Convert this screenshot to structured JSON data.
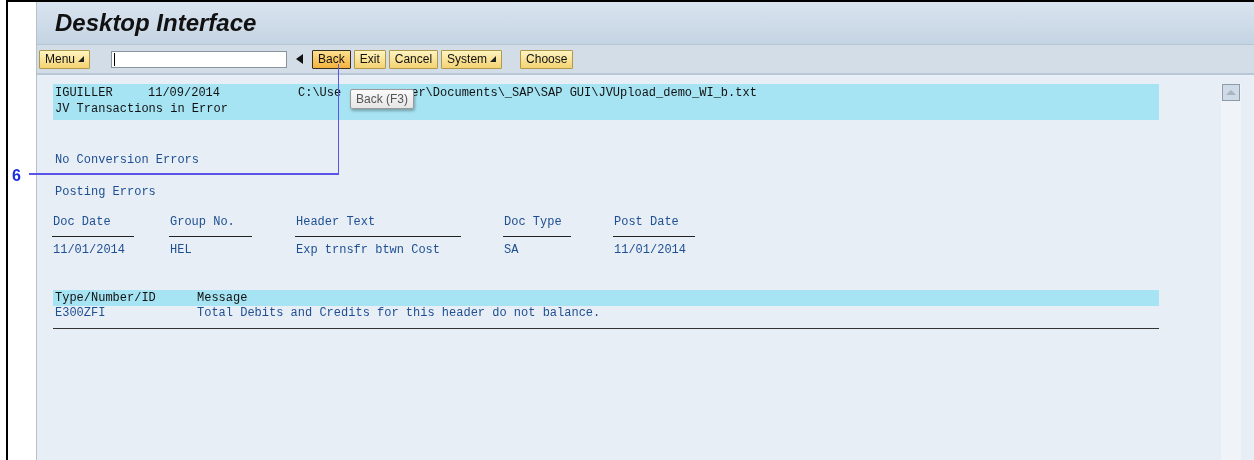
{
  "window": {
    "title": "Desktop Interface"
  },
  "toolbar": {
    "buttons": [
      {
        "label": "Menu",
        "kind": "dropdown",
        "hovered": false
      }
    ],
    "nav_buttons": [
      {
        "label": "Back",
        "kind": "plain",
        "hovered": true
      },
      {
        "label": "Exit",
        "kind": "plain",
        "hovered": false
      },
      {
        "label": "Cancel",
        "kind": "plain",
        "hovered": false
      },
      {
        "label": "System",
        "kind": "dropdown",
        "hovered": false
      }
    ],
    "choose_button": {
      "label": "Choose",
      "hovered": false
    }
  },
  "tooltip": {
    "text": "Back (F3)"
  },
  "callout": {
    "number": "6"
  },
  "report": {
    "header": {
      "user": "IGUILLER",
      "date": "11/09/2014",
      "path_parts": [
        "C:\\Use",
        "er\\Documents\\_SAP\\SAP GUI\\JVUpload_demo_WI_b.txt"
      ],
      "title": "JV Transactions in Error"
    },
    "conversion_status": "No Conversion Errors",
    "section_title": "Posting Errors",
    "columns": [
      "Doc Date",
      "Group No.",
      "Header Text",
      "Doc Type",
      "Post Date"
    ],
    "rows": [
      [
        "11/01/2014",
        "HEL",
        "Exp trnsfr btwn Cost",
        "SA",
        "11/01/2014"
      ]
    ],
    "messages": {
      "columns": [
        "Type/Number/ID",
        "Message"
      ],
      "rows": [
        [
          "E300ZFI",
          "Total Debits and Credits for this header do not balance."
        ]
      ]
    }
  }
}
